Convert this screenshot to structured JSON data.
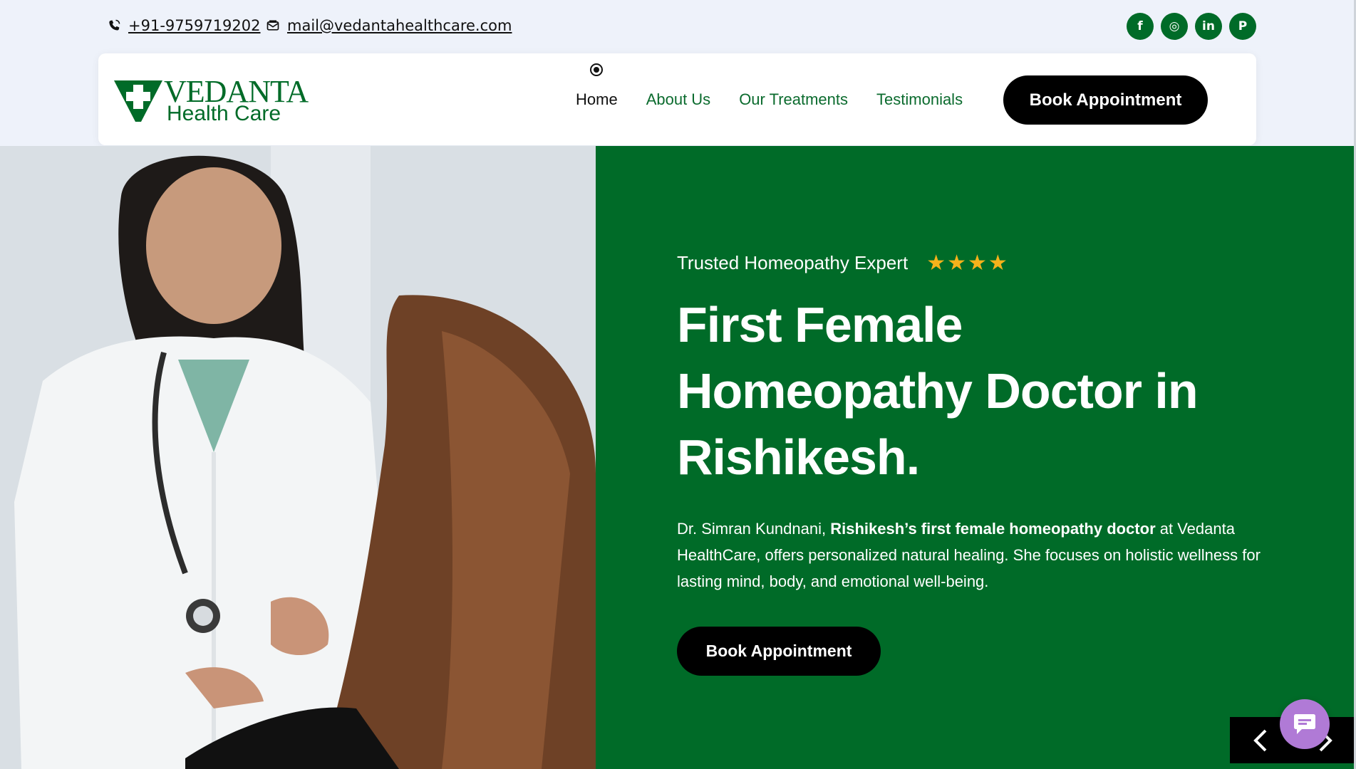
{
  "topbar": {
    "phone": "+91-9759719202",
    "email": "mail@vedantahealthcare.com",
    "socials": [
      {
        "icon": "facebook-icon",
        "glyph": "f"
      },
      {
        "icon": "instagram-icon",
        "glyph": "◎"
      },
      {
        "icon": "linkedin-icon",
        "glyph": "in"
      },
      {
        "icon": "pinterest-icon",
        "glyph": "P"
      }
    ]
  },
  "logo": {
    "name": "VEDANTA",
    "subtitle": "Health Care"
  },
  "nav": {
    "items": [
      "Home",
      "About Us",
      "Our Treatments",
      "Testimonials"
    ],
    "active": "Home",
    "cta": "Book Appointment"
  },
  "hero": {
    "eyebrow": "Trusted Homeopathy Expert",
    "rating_stars": 4,
    "headline_lines": [
      "First Female",
      "Homeopathy Doctor in",
      "Rishikesh."
    ],
    "lead_prefix": "Dr. Simran Kundnani, ",
    "lead_bold": "Rishikesh’s first female homeopathy doctor",
    "lead_suffix": " at Vedanta HealthCare, offers personalized natural healing. She focuses on holistic wellness for lasting mind, body, and emotional well-being.",
    "cta": "Book Appointment"
  },
  "colors": {
    "brand_green": "#006b28",
    "star": "#f6b21b",
    "chat": "#b07ad6"
  }
}
